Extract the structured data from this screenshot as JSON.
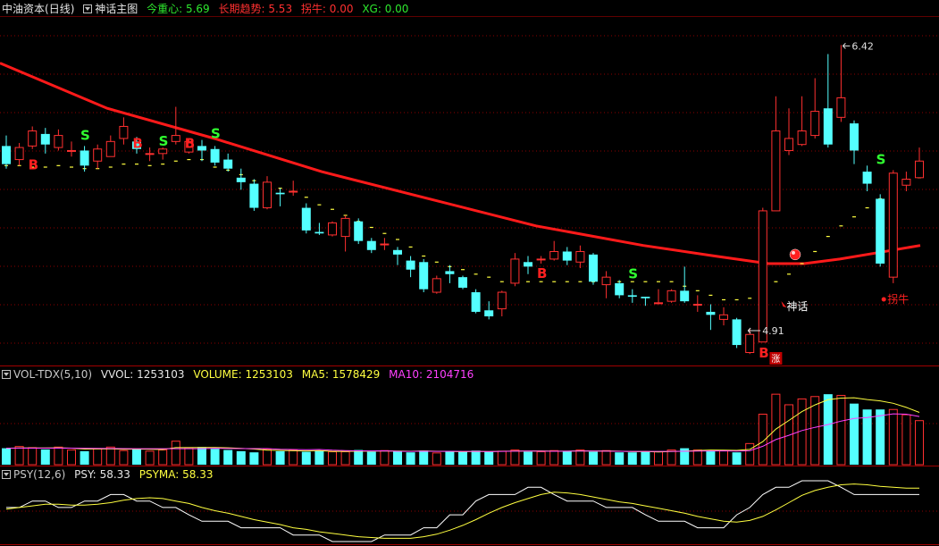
{
  "main_header": {
    "instrument": "中油资本",
    "period": "(日线)",
    "indicator": "神话主图",
    "metrics": [
      {
        "label": "今重心:",
        "value": "5.69",
        "color": "#2ee82e"
      },
      {
        "label": "长期趋势:",
        "value": "5.53",
        "color": "#ff3030"
      },
      {
        "label": "拐牛:",
        "value": "0.00",
        "color": "#ff3030"
      },
      {
        "label": "XG:",
        "value": "0.00",
        "color": "#2ee82e"
      }
    ]
  },
  "vol_header": {
    "name": "VOL-TDX(5,10)",
    "vvol_label": "VVOL:",
    "vvol_value": "1253103",
    "volume_label": "VOLUME:",
    "volume_value": "1253103",
    "ma5_label": "MA5:",
    "ma5_value": "1578429",
    "ma10_label": "MA10:",
    "ma10_value": "2104716"
  },
  "psy_header": {
    "name": "PSY(12,6)",
    "psy_label": "PSY:",
    "psy_value": "58.33",
    "psyma_label": "PSYMA:",
    "psyma_value": "58.33"
  },
  "annotations": {
    "high_label": "6.42",
    "low_label": "4.91",
    "shenhua_label": "神话",
    "guainiu_label": "拐牛",
    "zhang_label": "涨"
  },
  "colors": {
    "up": "#ff3030",
    "down": "#54ffff",
    "trend": "#ff1a1a",
    "dash": "#ffff40",
    "ma5": "#ffff40",
    "ma10": "#ff40ff",
    "psy": "#ffffff",
    "psyma": "#ffff40",
    "grid": "#8b0000",
    "buy": "#ff2020",
    "sell": "#30ff30"
  },
  "chart_data": {
    "type": "candlestick",
    "high_marker": 6.42,
    "low_marker": 4.91,
    "candles": [
      [
        5.75,
        5.63,
        5.82,
        5.6
      ],
      [
        5.66,
        5.74,
        5.77,
        5.62
      ],
      [
        5.75,
        5.85,
        5.88,
        5.73
      ],
      [
        5.83,
        5.76,
        5.87,
        5.7
      ],
      [
        5.74,
        5.82,
        5.86,
        5.72
      ],
      [
        5.72,
        5.72,
        5.78,
        5.68
      ],
      [
        5.72,
        5.62,
        5.75,
        5.58
      ],
      [
        5.65,
        5.73,
        5.76,
        5.6
      ],
      [
        5.68,
        5.78,
        5.82,
        5.68
      ],
      [
        5.8,
        5.88,
        5.94,
        5.76
      ],
      [
        5.78,
        5.73,
        5.81,
        5.7
      ],
      [
        5.7,
        5.7,
        5.74,
        5.65
      ],
      [
        5.7,
        5.73,
        5.74,
        5.66
      ],
      [
        5.78,
        5.82,
        6.01,
        5.76
      ],
      [
        5.71,
        5.78,
        5.8,
        5.7
      ],
      [
        5.75,
        5.72,
        5.79,
        5.65
      ],
      [
        5.73,
        5.64,
        5.75,
        5.62
      ],
      [
        5.66,
        5.6,
        5.7,
        5.58
      ],
      [
        5.54,
        5.51,
        5.6,
        5.46
      ],
      [
        5.5,
        5.34,
        5.53,
        5.32
      ],
      [
        5.34,
        5.51,
        5.55,
        5.33
      ],
      [
        5.44,
        5.43,
        5.47,
        5.35
      ],
      [
        5.45,
        5.45,
        5.52,
        5.42
      ],
      [
        5.34,
        5.19,
        5.37,
        5.17
      ],
      [
        5.18,
        5.17,
        5.24,
        5.16
      ],
      [
        5.16,
        5.24,
        5.25,
        5.15
      ],
      [
        5.15,
        5.27,
        5.29,
        5.05
      ],
      [
        5.25,
        5.12,
        5.27,
        5.1
      ],
      [
        5.12,
        5.06,
        5.14,
        5.04
      ],
      [
        5.1,
        5.1,
        5.14,
        5.06
      ],
      [
        5.06,
        5.03,
        5.08,
        4.96
      ],
      [
        4.99,
        4.93,
        5.02,
        4.88
      ],
      [
        4.98,
        4.8,
        5.0,
        4.78
      ],
      [
        4.78,
        4.87,
        4.89,
        4.77
      ],
      [
        4.92,
        4.9,
        4.96,
        4.84
      ],
      [
        4.88,
        4.81,
        4.89,
        4.8
      ],
      [
        4.78,
        4.65,
        4.8,
        4.64
      ],
      [
        4.66,
        4.62,
        4.72,
        4.6
      ],
      [
        4.67,
        4.78,
        4.79,
        4.62
      ],
      [
        4.84,
        5.0,
        5.04,
        4.82
      ],
      [
        4.98,
        4.95,
        5.02,
        4.9
      ],
      [
        5.0,
        5.0,
        5.02,
        4.97
      ],
      [
        5.0,
        5.05,
        5.12,
        4.99
      ],
      [
        5.05,
        4.99,
        5.08,
        4.96
      ],
      [
        4.98,
        5.05,
        5.09,
        4.94
      ],
      [
        5.03,
        4.85,
        5.04,
        4.83
      ],
      [
        4.83,
        4.88,
        4.92,
        4.74
      ],
      [
        4.84,
        4.76,
        4.86,
        4.74
      ],
      [
        4.76,
        4.75,
        4.8,
        4.71
      ],
      [
        4.75,
        4.74,
        4.75,
        4.69
      ],
      [
        4.71,
        4.71,
        4.8,
        4.7
      ],
      [
        4.72,
        4.79,
        4.8,
        4.71
      ],
      [
        4.79,
        4.72,
        4.95,
        4.71
      ],
      [
        4.7,
        4.7,
        4.76,
        4.65
      ],
      [
        4.65,
        4.63,
        4.7,
        4.53
      ],
      [
        4.6,
        4.63,
        4.68,
        4.56
      ],
      [
        4.6,
        4.43,
        4.61,
        4.41
      ],
      [
        4.38,
        4.5,
        4.54,
        4.37
      ],
      [
        4.45,
        5.32,
        5.34,
        4.45
      ],
      [
        5.32,
        5.85,
        6.08,
        5.32
      ],
      [
        5.72,
        5.8,
        6.0,
        5.69
      ],
      [
        5.76,
        5.85,
        6.08,
        5.75
      ],
      [
        5.82,
        5.98,
        6.2,
        5.8
      ],
      [
        6.0,
        5.76,
        6.36,
        5.74
      ],
      [
        5.94,
        6.07,
        6.42,
        5.91
      ],
      [
        5.9,
        5.72,
        5.92,
        5.63
      ],
      [
        5.58,
        5.5,
        5.62,
        5.45
      ],
      [
        5.4,
        4.97,
        5.43,
        4.95
      ],
      [
        4.88,
        5.57,
        5.59,
        4.84
      ],
      [
        5.49,
        5.53,
        5.58,
        5.45
      ],
      [
        5.54,
        5.65,
        5.74,
        5.54
      ]
    ],
    "dash_series": [
      5.62,
      5.62,
      5.61,
      5.61,
      5.62,
      5.61,
      5.6,
      5.6,
      5.61,
      5.63,
      5.63,
      5.62,
      5.63,
      5.65,
      5.66,
      5.66,
      5.61,
      5.59,
      5.56,
      5.52,
      5.49,
      5.47,
      5.45,
      5.41,
      5.36,
      5.33,
      5.29,
      5.25,
      5.21,
      5.17,
      5.13,
      5.08,
      5.02,
      4.98,
      4.95,
      4.93,
      4.9,
      4.88,
      4.85,
      4.85,
      4.85,
      4.85,
      4.85,
      4.85,
      4.85,
      4.85,
      4.85,
      4.85,
      4.85,
      4.85,
      4.85,
      4.85,
      4.82,
      4.79,
      4.76,
      4.73,
      4.73,
      4.74,
      4.79,
      4.85,
      4.9,
      4.97,
      5.05,
      5.15,
      5.22,
      5.28,
      5.34,
      5.4,
      5.45,
      5.5,
      5.54
    ],
    "signals": [
      {
        "i": 1,
        "type": "B"
      },
      {
        "i": 5,
        "type": "S"
      },
      {
        "i": 9,
        "type": "B"
      },
      {
        "i": 11,
        "type": "S"
      },
      {
        "i": 13,
        "type": "B"
      },
      {
        "i": 15,
        "type": "S"
      },
      {
        "i": 40,
        "type": "B"
      },
      {
        "i": 47,
        "type": "S"
      },
      {
        "i": 57,
        "type": "B"
      },
      {
        "i": 66,
        "type": "S"
      }
    ],
    "volume": [
      140,
      155,
      145,
      130,
      150,
      125,
      115,
      135,
      150,
      120,
      135,
      115,
      125,
      200,
      145,
      150,
      135,
      125,
      115,
      105,
      130,
      115,
      125,
      110,
      120,
      110,
      110,
      125,
      110,
      120,
      115,
      105,
      120,
      100,
      115,
      110,
      120,
      110,
      115,
      125,
      110,
      110,
      120,
      115,
      125,
      110,
      120,
      105,
      105,
      110,
      110,
      125,
      140,
      125,
      115,
      120,
      105,
      180,
      430,
      600,
      510,
      560,
      580,
      600,
      590,
      520,
      470,
      470,
      470,
      425,
      375
    ],
    "ma5": [
      140,
      142,
      143,
      143,
      144,
      141,
      133,
      134,
      135,
      131,
      133,
      131,
      129,
      145,
      145,
      147,
      147,
      144,
      139,
      133,
      124,
      122,
      119,
      117,
      120,
      113,
      113,
      115,
      115,
      117,
      116,
      114,
      117,
      114,
      113,
      110,
      113,
      111,
      114,
      116,
      116,
      117,
      115,
      115,
      118,
      116,
      117,
      115,
      111,
      112,
      109,
      112,
      115,
      121,
      125,
      124,
      122,
      130,
      196,
      303,
      377,
      452,
      509,
      553,
      567,
      570,
      555,
      543,
      523,
      488,
      445
    ],
    "ma10": [
      140,
      141,
      141,
      141,
      141,
      141,
      140,
      139,
      138,
      137,
      136,
      136,
      136,
      136,
      136,
      136,
      140,
      138,
      137,
      137,
      137,
      132,
      129,
      127,
      129,
      123,
      120,
      118,
      117,
      118,
      114,
      113,
      115,
      113,
      114,
      113,
      113,
      112,
      113,
      115,
      116,
      115,
      114,
      115,
      116,
      116,
      115,
      114,
      113,
      113,
      113,
      113,
      114,
      116,
      117,
      118,
      116,
      119,
      157,
      214,
      250,
      291,
      318,
      342,
      371,
      394,
      402,
      417,
      433,
      430,
      410
    ],
    "psy": [
      42,
      42,
      50,
      50,
      42,
      42,
      50,
      50,
      58,
      58,
      50,
      50,
      42,
      42,
      33,
      25,
      25,
      25,
      17,
      17,
      17,
      17,
      8,
      8,
      8,
      0,
      0,
      0,
      0,
      8,
      8,
      8,
      17,
      17,
      33,
      33,
      50,
      58,
      58,
      58,
      67,
      67,
      58,
      50,
      50,
      50,
      42,
      42,
      42,
      33,
      25,
      25,
      25,
      17,
      17,
      17,
      33,
      42,
      58,
      67,
      67,
      75,
      75,
      75,
      67,
      58,
      58,
      58,
      58,
      58,
      58
    ],
    "psyma": [
      40,
      42,
      44,
      46,
      46,
      45,
      45,
      46,
      48,
      51,
      53,
      54,
      53,
      50,
      47,
      42,
      38,
      35,
      31,
      27,
      24,
      21,
      17,
      15,
      12,
      10,
      8,
      6,
      5,
      4,
      4,
      4,
      6,
      9,
      14,
      20,
      27,
      35,
      42,
      48,
      53,
      58,
      61,
      60,
      58,
      55,
      52,
      49,
      47,
      44,
      41,
      38,
      35,
      31,
      28,
      25,
      24,
      26,
      31,
      39,
      48,
      57,
      63,
      67,
      70,
      71,
      70,
      68,
      67,
      66,
      66
    ],
    "long_trend": [
      [
        0,
        6.3
      ],
      [
        120,
        6.0
      ],
      [
        240,
        5.8
      ],
      [
        360,
        5.58
      ],
      [
        480,
        5.4
      ],
      [
        600,
        5.22
      ],
      [
        720,
        5.09
      ],
      [
        800,
        5.02
      ],
      [
        860,
        4.97
      ],
      [
        900,
        4.97
      ],
      [
        940,
        5.0
      ],
      [
        980,
        5.04
      ],
      [
        1030,
        5.09
      ]
    ],
    "price_range": [
      4.3,
      6.6
    ],
    "volume_range": [
      0,
      700
    ],
    "psy_range": [
      0,
      75
    ]
  }
}
